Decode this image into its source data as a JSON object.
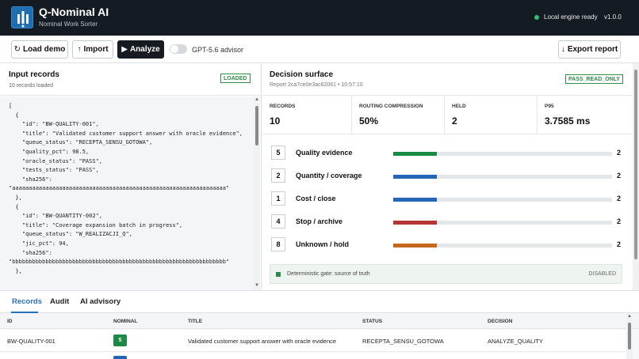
{
  "app": {
    "title": "Q-Nominal AI",
    "subtitle": "Nominal Work Sorter",
    "engine_status": "Local engine ready",
    "version": "v1.0.0"
  },
  "toolbar": {
    "load_demo": "Load demo",
    "import": "Import",
    "analyze": "Analyze",
    "advisor_label": "GPT-5.6 advisor",
    "advisor_on": false,
    "export": "Export report"
  },
  "input": {
    "title": "Input records",
    "count_text": "10 records loaded",
    "badge": "LOADED",
    "json_text": "[\n  {\n    \"id\": \"BW-QUALITY-001\",\n    \"title\": \"Validated customer support answer with oracle evidence\",\n    \"queue_status\": \"RECEPTA_SENSU_GOTOWA\",\n    \"quality_pct\": 98.5,\n    \"oracle_status\": \"PASS\",\n    \"tests_status\": \"PASS\",\n    \"sha256\":\n\"aaaaaaaaaaaaaaaaaaaaaaaaaaaaaaaaaaaaaaaaaaaaaaaaaaaaaaaaaaaaaaaa\"\n  },\n  {\n    \"id\": \"BW-QUANTITY-002\",\n    \"title\": \"Coverage expansion batch in progress\",\n    \"queue_status\": \"W_REALIZACJI_Q\",\n    \"jic_pct\": 94,\n    \"sha256\":\n\"bbbbbbbbbbbbbbbbbbbbbbbbbbbbbbbbbbbbbbbbbbbbbbbbbbbbbbbbbbbbbbbb\"\n  },"
  },
  "decision": {
    "title": "Decision surface",
    "report_line": "Report 2ca7ce0e3ac62061 • 10:57:10",
    "badge": "PASS_READ_ONLY",
    "metrics": [
      {
        "label": "RECORDS",
        "value": "10"
      },
      {
        "label": "ROUTING COMPRESSION",
        "value": "50%"
      },
      {
        "label": "HELD",
        "value": "2"
      },
      {
        "label": "P95",
        "value": "3.7585 ms"
      }
    ],
    "buckets": [
      {
        "code": "5",
        "label": "Quality evidence",
        "count": "2",
        "share": 0.2,
        "color": "#1b8a45"
      },
      {
        "code": "2",
        "label": "Quantity / coverage",
        "count": "2",
        "share": 0.2,
        "color": "#2466b5"
      },
      {
        "code": "1",
        "label": "Cost / close",
        "count": "2",
        "share": 0.2,
        "color": "#2466b5"
      },
      {
        "code": "4",
        "label": "Stop / archive",
        "count": "2",
        "share": 0.2,
        "color": "#b33636"
      },
      {
        "code": "8",
        "label": "Unknown / hold",
        "count": "2",
        "share": 0.2,
        "color": "#c46a1f"
      }
    ],
    "gate_label": "Deterministic gate: source of truth",
    "gate_state": "DISABLED"
  },
  "tabs": [
    "Records",
    "Audit",
    "AI advisory"
  ],
  "table": {
    "headers": [
      "ID",
      "NOMINAL",
      "TITLE",
      "STATUS",
      "DECISION"
    ],
    "rows": [
      {
        "id": "BW-QUALITY-001",
        "nominal": "5",
        "title": "Validated customer support answer with oracle evidence",
        "status": "RECEPTA_SENSU_GOTOWA",
        "decision": "ANALYZE_QUALITY"
      }
    ]
  }
}
